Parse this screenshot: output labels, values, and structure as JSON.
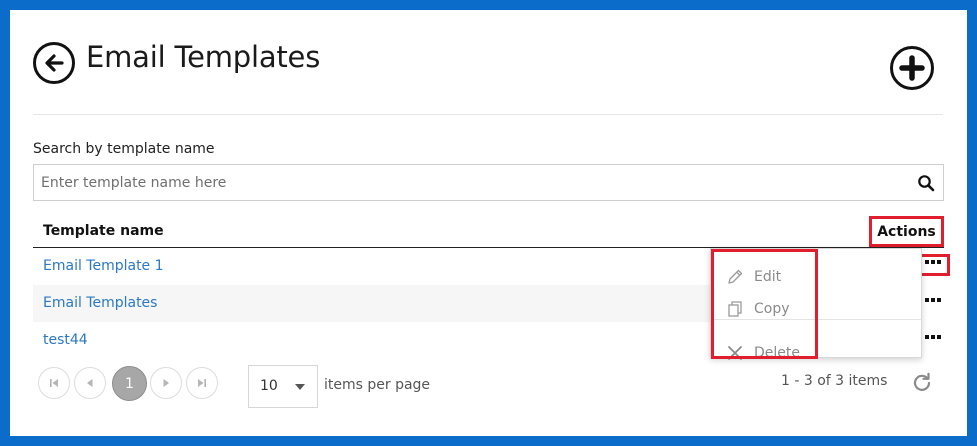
{
  "header": {
    "title": "Email Templates",
    "back_icon": "arrow-left-circle-icon",
    "add_icon": "plus-circle-icon"
  },
  "search": {
    "label": "Search by template name",
    "placeholder": "Enter template name here",
    "value": "",
    "icon": "search-icon"
  },
  "table": {
    "columns": [
      "Template name",
      "Actions"
    ],
    "rows": [
      {
        "name": "Email Template 1"
      },
      {
        "name": "Email Templates"
      },
      {
        "name": "test44"
      }
    ]
  },
  "actions_menu": {
    "items": [
      {
        "label": "Edit",
        "icon": "pencil-icon",
        "enabled": false
      },
      {
        "label": "Copy",
        "icon": "copy-icon",
        "enabled": false
      },
      {
        "label": "Delete",
        "icon": "close-icon",
        "enabled": false
      }
    ]
  },
  "pager": {
    "current_page": "1",
    "page_size": "10",
    "page_size_label": "items per page",
    "items_info": "1 - 3 of 3 items"
  },
  "colors": {
    "frame_border": "#0b6dc9",
    "highlight": "#e01e2d",
    "link": "#2b78c5",
    "pager_active": "#a7a7a7"
  }
}
